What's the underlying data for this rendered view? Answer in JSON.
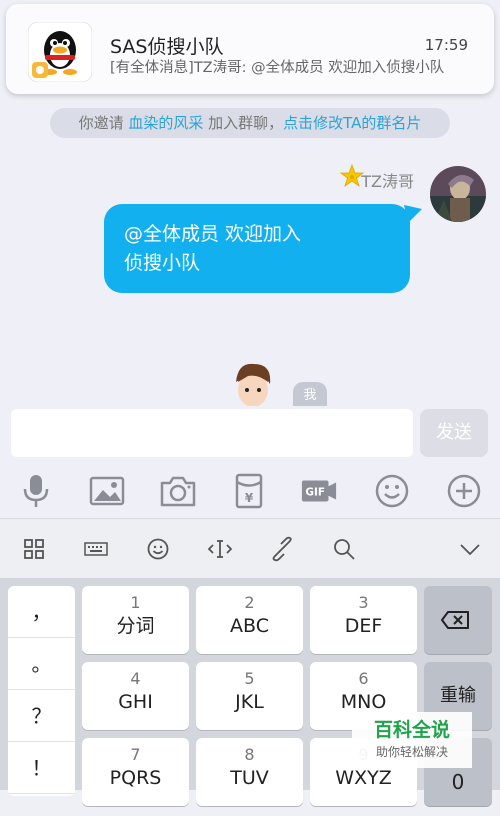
{
  "notification": {
    "title": "SAS侦搜小队",
    "time": "17:59",
    "message": "[有全体消息]TZ涛哥: @全体成员 欢迎加入侦搜小队",
    "icon": "qq-penguin-icon"
  },
  "system_tip": {
    "prefix": "你邀请",
    "invitee": "血染的风采",
    "middle": "加入群聊，",
    "action": "点击修改TA的群名片"
  },
  "message": {
    "sender": "TZ涛哥",
    "line1": "@全体成员 欢迎加入",
    "line2": "侦搜小队"
  },
  "sticker": {
    "label": "我"
  },
  "input": {
    "value": "",
    "placeholder": "",
    "send_label": "发送"
  },
  "toolbar": [
    "microphone-icon",
    "image-icon",
    "camera-icon",
    "red-packet-icon",
    "gif-icon",
    "emoji-icon",
    "plus-icon"
  ],
  "keyboard_top": [
    "grid-icon",
    "keyboard-icon",
    "emoji-icon",
    "cursor-icon",
    "link-icon",
    "search-icon",
    "collapse-icon"
  ],
  "punctuation": [
    "，",
    "。",
    "？",
    "！"
  ],
  "keys": [
    {
      "num": "1",
      "label": "分词"
    },
    {
      "num": "2",
      "label": "ABC"
    },
    {
      "num": "3",
      "label": "DEF"
    },
    {
      "num": "4",
      "label": "GHI"
    },
    {
      "num": "5",
      "label": "JKL"
    },
    {
      "num": "6",
      "label": "MNO"
    },
    {
      "num": "7",
      "label": "PQRS"
    },
    {
      "num": "8",
      "label": "TUV"
    },
    {
      "num": "9",
      "label": "WXYZ"
    }
  ],
  "side_keys": {
    "delete": "delete-icon",
    "reenter": "重输",
    "zero": "0"
  },
  "watermark": {
    "title": "百科全说",
    "subtitle": "助你轻松解决"
  },
  "colors": {
    "accent": "#12b0ee",
    "link": "#2aa3d8",
    "watermark": "#1ea44a"
  }
}
